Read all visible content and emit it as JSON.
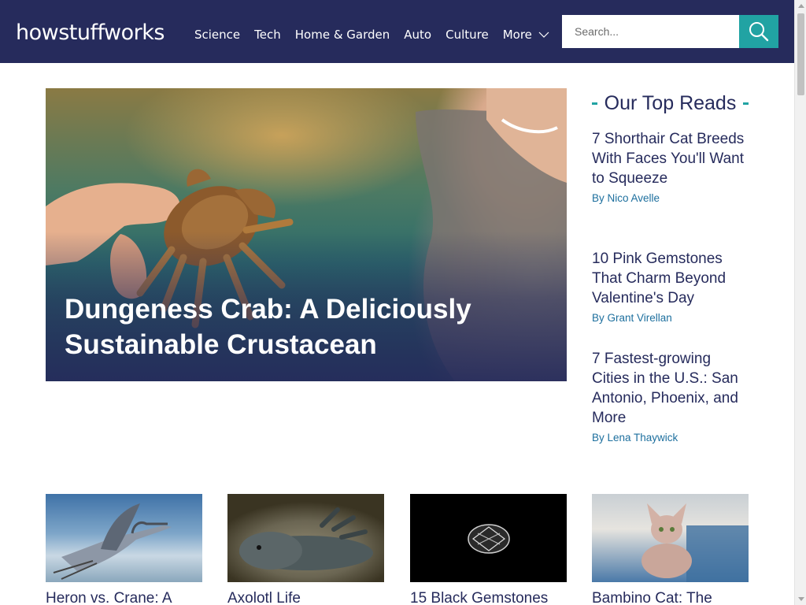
{
  "header": {
    "logo_text": "howstuffworks",
    "nav": [
      {
        "label": "Science"
      },
      {
        "label": "Tech"
      },
      {
        "label": "Home & Garden"
      },
      {
        "label": "Auto"
      },
      {
        "label": "Culture"
      },
      {
        "label": "More"
      }
    ],
    "search_placeholder": "Search...",
    "colors": {
      "header_bg": "#262b5c",
      "accent": "#21a3a3"
    }
  },
  "hero": {
    "title": "Dungeness Crab: A Deliciously Sustainable Crustacean"
  },
  "sidebar": {
    "heading": "Our Top Reads",
    "items": [
      {
        "title": "7 Shorthair Cat Breeds With Faces You'll Want to Squeeze",
        "author": "By Nico Avelle"
      },
      {
        "title": "10 Pink Gemstones That Charm Beyond Valentine's Day",
        "author": "By Grant Virellan"
      },
      {
        "title": "7 Fastest-growing Cities in the U.S.: San Antonio, Phoenix, and More",
        "author": "By Lena Thaywick"
      }
    ]
  },
  "cards": [
    {
      "title": "Heron vs. Crane: A",
      "image": "heron-image"
    },
    {
      "title": "Axolotl Life",
      "image": "axolotl-image"
    },
    {
      "title": "15 Black Gemstones",
      "image": "gemstone-image"
    },
    {
      "title": "Bambino Cat: The",
      "image": "cat-image"
    }
  ]
}
